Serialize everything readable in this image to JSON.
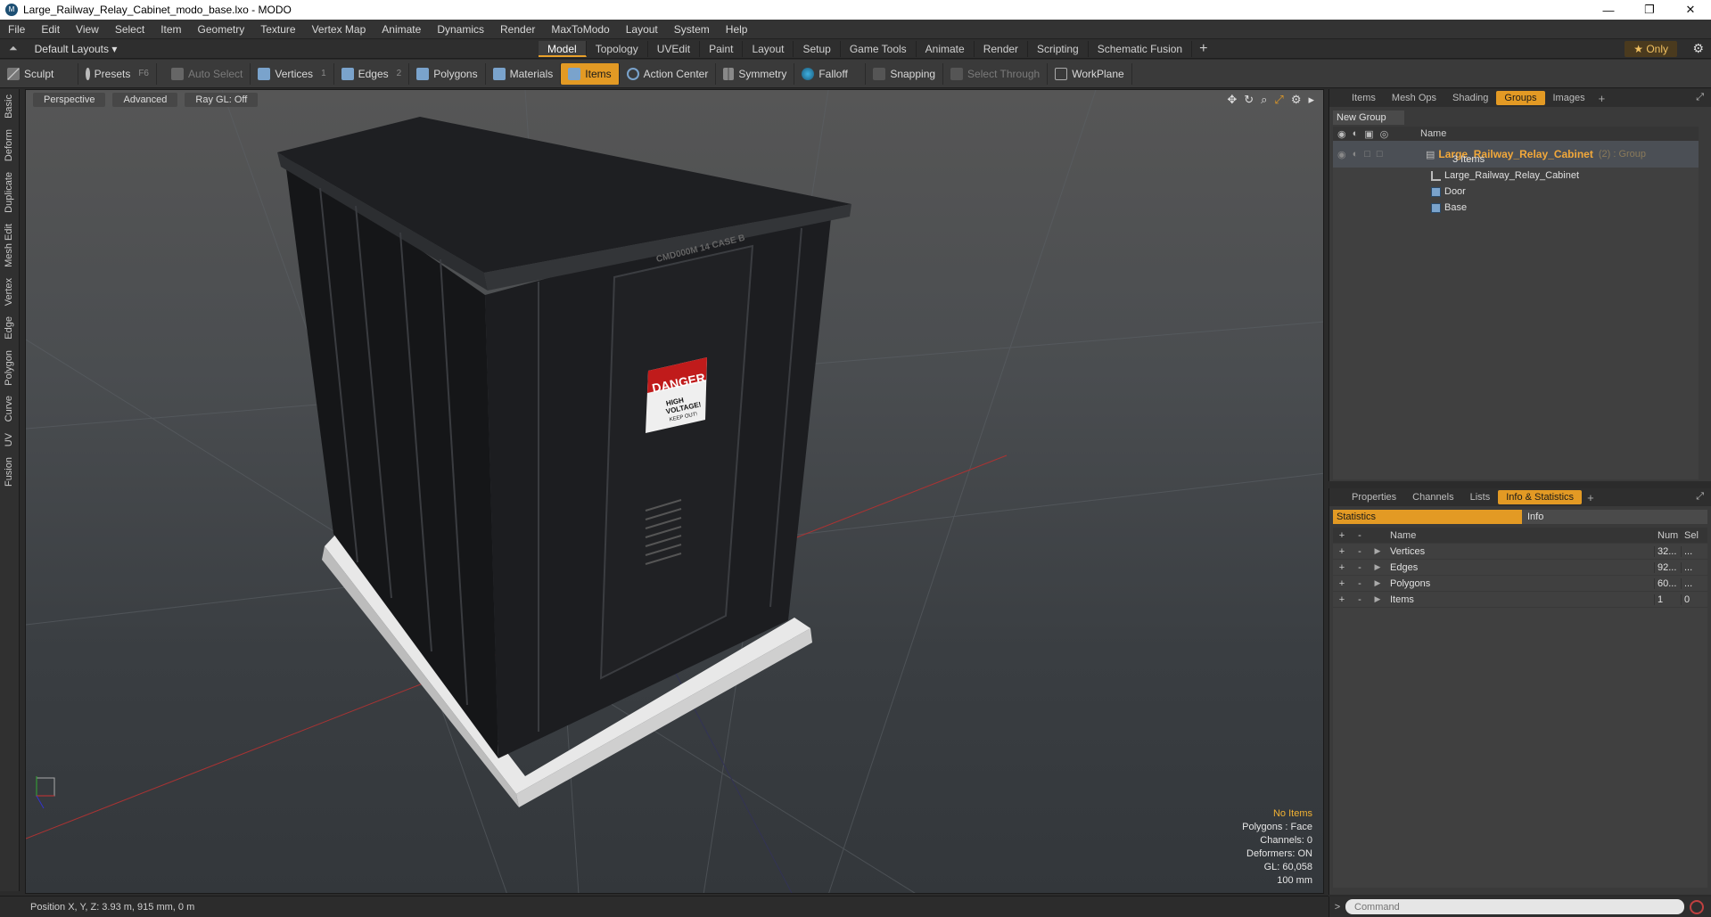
{
  "window": {
    "app_icon_letter": "M",
    "title": "Large_Railway_Relay_Cabinet_modo_base.lxo - MODO",
    "minimize": "—",
    "restore": "❐",
    "close": "✕"
  },
  "menu": [
    "File",
    "Edit",
    "View",
    "Select",
    "Item",
    "Geometry",
    "Texture",
    "Vertex Map",
    "Animate",
    "Dynamics",
    "Render",
    "MaxToModo",
    "Layout",
    "System",
    "Help"
  ],
  "layout_row": {
    "layout_selector": "Default Layouts ▾",
    "tabs": [
      "Model",
      "Topology",
      "UVEdit",
      "Paint",
      "Layout",
      "Setup",
      "Game Tools",
      "Animate",
      "Render",
      "Scripting",
      "Schematic Fusion"
    ],
    "active_tab": "Model",
    "add_tab": "+",
    "only_button": "★ Only",
    "gear": "⚙"
  },
  "toolbar": {
    "sculpt": "Sculpt",
    "presets": "Presets",
    "presets_key": "F6",
    "auto_select": "Auto Select",
    "vertices": "Vertices",
    "vertices_count": "1",
    "edges": "Edges",
    "edges_count": "2",
    "polygons": "Polygons",
    "materials": "Materials",
    "items": "Items",
    "action_center": "Action Center",
    "symmetry": "Symmetry",
    "falloff": "Falloff",
    "snapping": "Snapping",
    "select_through": "Select Through",
    "workplane": "WorkPlane"
  },
  "left_tabs": [
    "Basic",
    "Deform",
    "Duplicate",
    "Mesh Edit",
    "Vertex",
    "Edge",
    "Polygon",
    "Curve",
    "UV",
    "Fusion"
  ],
  "viewport": {
    "view_mode": "Perspective",
    "advanced": "Advanced",
    "raygl": "Ray GL: Off",
    "sign_danger": "DANGER",
    "sign_text_1": "HIGH",
    "sign_text_2": "VOLTAGE!",
    "sign_text_3": "KEEP OUT!",
    "cabinet_label": "CMD000M  14 CASE B",
    "info": {
      "no_items": "No Items",
      "polygons": "Polygons : Face",
      "channels": "Channels: 0",
      "deformers": "Deformers: ON",
      "gl": "GL: 60,058",
      "scale": "100 mm"
    }
  },
  "status": {
    "position": "Position X, Y, Z:  3.93 m, 915 mm, 0 m"
  },
  "groups_panel": {
    "tabs": [
      "Items",
      "Mesh Ops",
      "Shading",
      "Groups",
      "Images"
    ],
    "active_tab": "Groups",
    "new_group": "New Group",
    "col_name": "Name",
    "group_name": "Large_Railway_Relay_Cabinet",
    "group_suffix": "(2) : Group",
    "group_count": "3 Items",
    "children": [
      "Large_Railway_Relay_Cabinet",
      "Door",
      "Base"
    ]
  },
  "stats_panel": {
    "tabs": [
      "Properties",
      "Channels",
      "Lists",
      "Info & Statistics"
    ],
    "active_tab": "Info & Statistics",
    "statistics": "Statistics",
    "info": "Info",
    "headers": {
      "name": "Name",
      "num": "Num",
      "sel": "Sel"
    },
    "rows": [
      {
        "name": "Vertices",
        "num": "32...",
        "sel": "..."
      },
      {
        "name": "Edges",
        "num": "92...",
        "sel": "..."
      },
      {
        "name": "Polygons",
        "num": "60...",
        "sel": "..."
      },
      {
        "name": "Items",
        "num": "1",
        "sel": "0"
      }
    ]
  },
  "command": {
    "prompt": ">",
    "placeholder": "Command"
  }
}
